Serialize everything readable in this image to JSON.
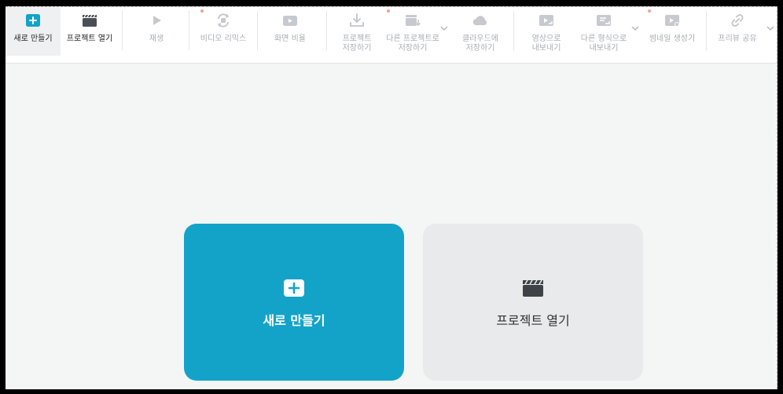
{
  "toolbar": {
    "items": [
      {
        "id": "new",
        "label": "새로 만들기",
        "icon": "plus-square-icon"
      },
      {
        "id": "open",
        "label": "프로젝트 열기",
        "icon": "clapperboard-icon"
      },
      {
        "id": "play",
        "label": "재생",
        "icon": "play-icon"
      },
      {
        "id": "remix",
        "label": "비디오 리믹스",
        "icon": "remix-icon"
      },
      {
        "id": "ratio",
        "label": "화면 비율",
        "icon": "screen-ratio-icon"
      },
      {
        "id": "save",
        "label": "프로젝트\n저장하기",
        "icon": "download-icon"
      },
      {
        "id": "save_as",
        "label": "다른 프로젝트로\n저장하기",
        "icon": "save-as-icon"
      },
      {
        "id": "cloud",
        "label": "클라우드에\n저장하기",
        "icon": "cloud-icon"
      },
      {
        "id": "export_video",
        "label": "영상으로\n내보내기",
        "icon": "export-video-icon"
      },
      {
        "id": "export_format",
        "label": "다른 형식으로\n내보내기",
        "icon": "export-format-icon"
      },
      {
        "id": "thumbnail",
        "label": "썸네일 생성기",
        "icon": "thumbnail-icon"
      },
      {
        "id": "share",
        "label": "프리뷰 공유",
        "icon": "link-icon"
      }
    ]
  },
  "cards": {
    "new_label": "새로 만들기",
    "open_label": "프로젝트 열기"
  },
  "colors": {
    "accent": "#13a3c9",
    "disabled_text": "#a8adb3",
    "card_secondary": "#e9eaec"
  }
}
